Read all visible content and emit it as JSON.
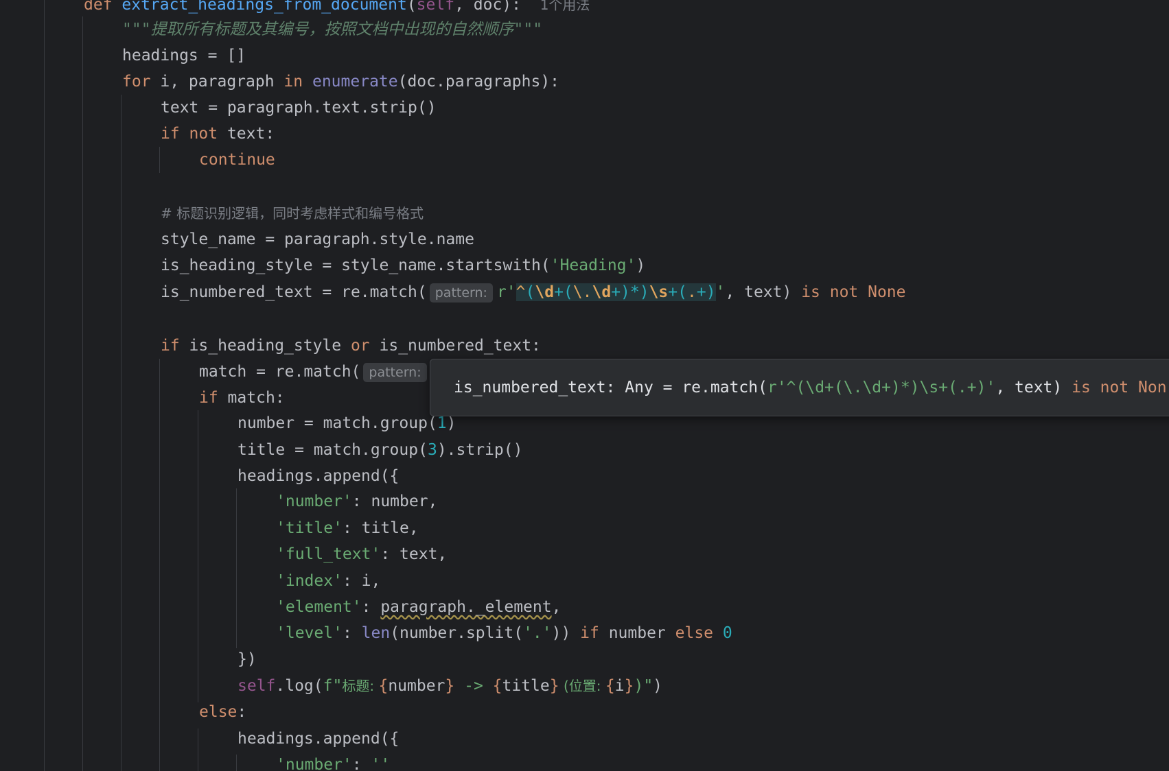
{
  "editor": {
    "usage_hint": "1个用法",
    "param_hint": "pattern:",
    "docstring": "\"\"\"提取所有标题及其编号，按照文档中出现的自然顺序\"\"\"",
    "comment": "# 标题识别逻辑，同时考虑样式和编号格式",
    "func_name": "extract_headings_from_document",
    "heading_style_str": "'Heading'",
    "key_number": "'number'",
    "key_title": "'title'",
    "key_full_text": "'full_text'",
    "key_index": "'index'",
    "key_element": "'element'",
    "key_level": "'level'",
    "dot_str": "'.'",
    "empty_str": "''",
    "log_label_title": "标题: ",
    "log_label_pos": " (位置: "
  },
  "tooltip": {
    "signature_prefix": "is_numbered_text: Any = re.match(",
    "signature_regex": "r'^(\\d+(\\.\\d+)*)\\s+(.+)'",
    "signature_suffix": ", text) ",
    "signature_kw": "is not Non"
  },
  "colors": {
    "background": "#1e1f22",
    "keyword": "#cf8e6d",
    "function": "#56a8f5",
    "string": "#6aab73",
    "number": "#2aacb8",
    "comment": "#7a7e85"
  }
}
